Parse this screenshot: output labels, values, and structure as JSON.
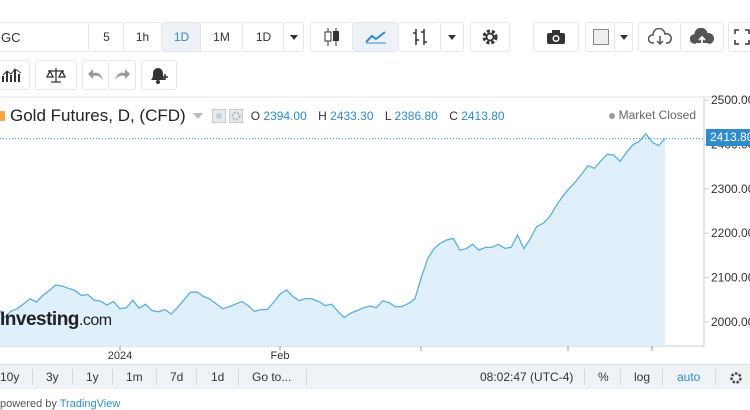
{
  "toolbar": {
    "symbol": "GC",
    "intervals": [
      "5",
      "1h",
      "1D",
      "1M",
      "1D"
    ],
    "active_interval_index": 2
  },
  "legend": {
    "title": "Gold Futures, D, (CFD)",
    "open_label": "O",
    "open": "2394.00",
    "high_label": "H",
    "high": "2433.30",
    "low_label": "L",
    "low": "2386.80",
    "close_label": "C",
    "close": "2413.80"
  },
  "status": {
    "market": "Market Closed"
  },
  "logo": {
    "name": "Investing",
    "domain": ".com"
  },
  "last_price_tag": "2413.80",
  "bottom_bar": {
    "ranges": [
      "10y",
      "3y",
      "1y",
      "1m",
      "7d",
      "1d",
      "Go to..."
    ],
    "time": "08:02:47 (UTC-4)",
    "percent": "%",
    "log": "log",
    "auto": "auto"
  },
  "footer": {
    "powered_by": "powered by",
    "provider": "TradingView"
  },
  "colors": {
    "accent": "#2d8ccb",
    "area_fill": "#dff0fa",
    "area_line": "#5aaee0",
    "grid_line": "#2d8ccb"
  },
  "chart_data": {
    "type": "area",
    "title": "Gold Futures, D, (CFD)",
    "xlabel": "",
    "ylabel": "",
    "x_tick_labels": [
      "2024",
      "Feb"
    ],
    "y_ticks": [
      2000,
      2100,
      2200,
      2300,
      2400,
      2500
    ],
    "y_tick_labels": [
      "2000.00",
      "2100.00",
      "2200.00",
      "2300.00",
      "2400.00",
      "2500.00"
    ],
    "ylim": [
      1920,
      2540
    ],
    "grid": false,
    "series": [
      {
        "values": [
          2032,
          2010,
          2024,
          2030,
          2041,
          2052,
          2045,
          2060,
          2071,
          2083,
          2081,
          2076,
          2071,
          2060,
          2062,
          2049,
          2047,
          2038,
          2046,
          2030,
          2032,
          2049,
          2031,
          2040,
          2026,
          2023,
          2028,
          2018,
          2033,
          2050,
          2067,
          2068,
          2058,
          2052,
          2041,
          2030,
          2034,
          2040,
          2046,
          2037,
          2024,
          2028,
          2028,
          2045,
          2063,
          2072,
          2057,
          2048,
          2053,
          2052,
          2046,
          2037,
          2040,
          2024,
          2010,
          2020,
          2026,
          2032,
          2036,
          2032,
          2048,
          2043,
          2034,
          2035,
          2042,
          2052,
          2100,
          2143,
          2165,
          2178,
          2185,
          2188,
          2162,
          2165,
          2175,
          2162,
          2168,
          2168,
          2175,
          2166,
          2168,
          2196,
          2165,
          2188,
          2215,
          2222,
          2237,
          2261,
          2282,
          2300,
          2315,
          2333,
          2352,
          2346,
          2363,
          2378,
          2376,
          2362,
          2382,
          2399,
          2407,
          2424,
          2405,
          2397,
          2413
        ]
      }
    ]
  }
}
